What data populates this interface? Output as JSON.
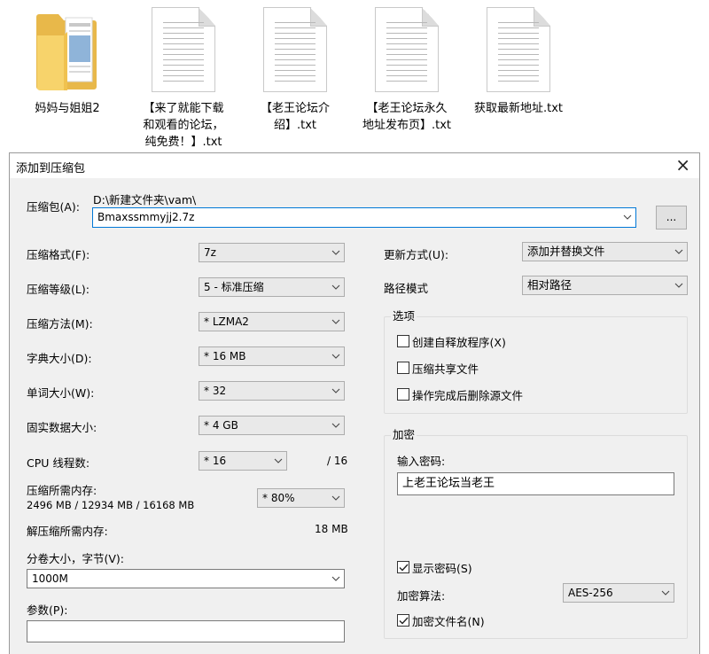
{
  "explorer": {
    "files": [
      {
        "name": "妈妈与姐姐2",
        "icon": "folder-icon"
      },
      {
        "name": "【来了就能下载\n和观看的论坛，\n纯免费！】.txt",
        "icon": "text-file-icon"
      },
      {
        "name": "【老王论坛介\n绍】.txt",
        "icon": "text-file-icon"
      },
      {
        "name": "【老王论坛永久\n地址发布页】.txt",
        "icon": "text-file-icon"
      },
      {
        "name": "获取最新地址.txt",
        "icon": "text-file-icon"
      }
    ]
  },
  "dialog": {
    "title": "添加到压缩包",
    "close_icon": "×",
    "archive": {
      "label": "压缩包(A):",
      "path": "D:\\新建文件夹\\vam\\",
      "filename": "Bmaxssmmyjj2.7z",
      "browse_label": "..."
    },
    "left": {
      "format_label": "压缩格式(F):",
      "format_value": "7z",
      "level_label": "压缩等级(L):",
      "level_value": "5 - 标准压缩",
      "method_label": "压缩方法(M):",
      "method_value": "* LZMA2",
      "dict_label": "字典大小(D):",
      "dict_value": "* 16 MB",
      "word_label": "单词大小(W):",
      "word_value": "* 32",
      "solid_label": "固实数据大小:",
      "solid_value": "* 4 GB",
      "threads_label": "CPU 线程数:",
      "threads_value": "* 16",
      "threads_max": "/ 16",
      "mem_comp_label": "压缩所需内存:",
      "mem_comp_detail": "2496 MB / 12934 MB / 16168 MB",
      "mem_comp_value": "* 80%",
      "mem_decomp_label": "解压缩所需内存:",
      "mem_decomp_value": "18 MB",
      "volume_label": "分卷大小，字节(V):",
      "volume_value": "1000M",
      "params_label": "参数(P):",
      "params_value": ""
    },
    "right": {
      "update_label": "更新方式(U):",
      "update_value": "添加并替换文件",
      "pathmode_label": "路径模式",
      "pathmode_value": "相对路径",
      "options": {
        "title": "选项",
        "sfx_label": "创建自释放程序(X)",
        "sfx_checked": false,
        "shared_label": "压缩共享文件",
        "shared_checked": false,
        "delete_label": "操作完成后删除源文件",
        "delete_checked": false
      },
      "encryption": {
        "title": "加密",
        "password_label": "输入密码:",
        "password_value": "上老王论坛当老王",
        "show_password_label": "显示密码(S)",
        "show_password_checked": true,
        "method_label": "加密算法:",
        "method_value": "AES-256",
        "encrypt_names_label": "加密文件名(N)",
        "encrypt_names_checked": true
      }
    }
  }
}
